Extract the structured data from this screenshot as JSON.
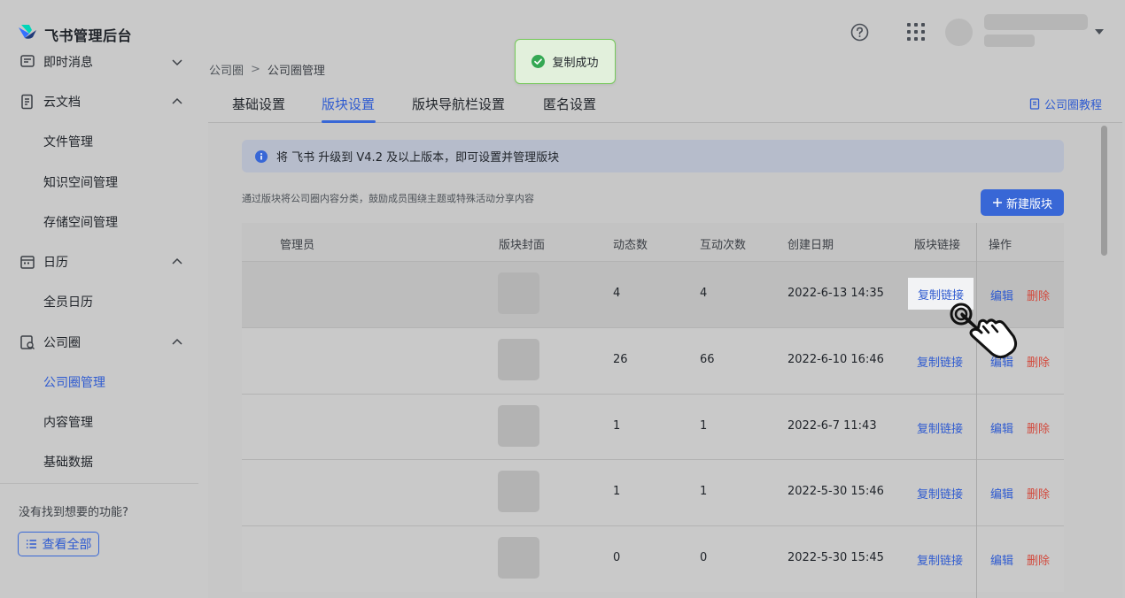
{
  "app": {
    "brand": "飞书管理后台"
  },
  "header": {
    "help_icon": "help-circle-icon",
    "apps_icon": "grid-icon"
  },
  "sidebar": {
    "items": [
      {
        "label": "即时消息",
        "icon": "message-icon",
        "expanded": false
      },
      {
        "label": "云文档",
        "icon": "document-icon",
        "expanded": true
      },
      {
        "label": "文件管理"
      },
      {
        "label": "知识空间管理"
      },
      {
        "label": "存储空间管理"
      },
      {
        "label": "日历",
        "icon": "calendar-icon",
        "expanded": true
      },
      {
        "label": "全员日历"
      },
      {
        "label": "公司圈",
        "icon": "moments-icon",
        "expanded": true
      },
      {
        "label": "公司圈管理",
        "active": true
      },
      {
        "label": "内容管理"
      },
      {
        "label": "基础数据"
      }
    ],
    "missing_text": "没有找到想要的功能?",
    "view_all": "查看全部"
  },
  "breadcrumb": {
    "parent": "公司圈",
    "sep": ">",
    "current": "公司圈管理"
  },
  "toast": {
    "text": "复制成功"
  },
  "tabs": [
    {
      "label": "基础设置"
    },
    {
      "label": "版块设置",
      "active": true
    },
    {
      "label": "版块导航栏设置"
    },
    {
      "label": "匿名设置"
    }
  ],
  "tutorial": "公司圈教程",
  "banner": {
    "text": "将 飞书 升级到 V4.2 及以上版本，即可设置并管理版块"
  },
  "description": "通过版块将公司圈内容分类，鼓励成员围绕主题或特殊活动分享内容",
  "new_button": "新建版块",
  "table": {
    "headers": [
      "管理员",
      "版块封面",
      "动态数",
      "互动次数",
      "创建日期",
      "版块链接",
      "操作"
    ],
    "rows": [
      {
        "posts": "4",
        "interactions": "4",
        "date": "2022-6-13 14:35",
        "link": "复制链接",
        "edit": "编辑",
        "delete": "删除"
      },
      {
        "posts": "26",
        "interactions": "66",
        "date": "2022-6-10 16:46",
        "link": "复制链接",
        "edit": "编辑",
        "delete": "删除"
      },
      {
        "posts": "1",
        "interactions": "1",
        "date": "2022-6-7 11:43",
        "link": "复制链接",
        "edit": "编辑",
        "delete": "删除"
      },
      {
        "posts": "1",
        "interactions": "1",
        "date": "2022-5-30 15:46",
        "link": "复制链接",
        "edit": "编辑",
        "delete": "删除"
      },
      {
        "posts": "0",
        "interactions": "0",
        "date": "2022-5-30 15:45",
        "link": "复制链接",
        "edit": "编辑",
        "delete": "删除"
      }
    ]
  },
  "colors": {
    "accent": "#3867d6",
    "danger": "#d24a3d",
    "success": "#52c41a"
  }
}
